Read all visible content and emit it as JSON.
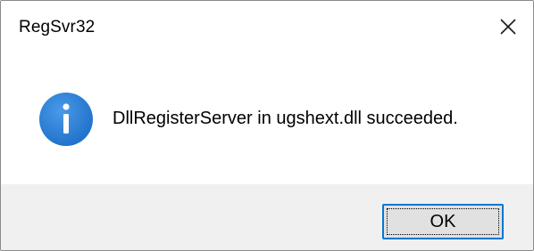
{
  "window": {
    "title": "RegSvr32"
  },
  "dialog": {
    "message": "DllRegisterServer in ugshext.dll succeeded.",
    "icon": "info-icon",
    "ok_label": "OK"
  },
  "colors": {
    "accent": "#0078d4",
    "icon_blue": "#2f7fd8",
    "footer_bg": "#f0f0f0"
  }
}
